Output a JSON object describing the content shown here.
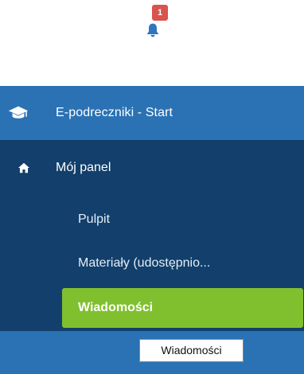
{
  "notifications": {
    "count": "1",
    "bell_icon": "bell-icon",
    "colors": {
      "bell": "#2f75c1",
      "badge": "#d9534f"
    }
  },
  "sidebar": {
    "brand": {
      "icon": "graduation-cap-icon",
      "title": "E-podreczniki - Start"
    },
    "panel": {
      "icon": "home-icon",
      "label": "Mój panel"
    },
    "items": [
      {
        "label": "Pulpit"
      },
      {
        "label": "Materiały (udostępnio..."
      }
    ],
    "active_item": {
      "label": "Wiadomości"
    },
    "colors": {
      "brand_bg": "#2a72b4",
      "nav_bg": "#123f6b",
      "active_bg": "#80c02f"
    }
  },
  "tooltip": {
    "text": "Wiadomości"
  }
}
